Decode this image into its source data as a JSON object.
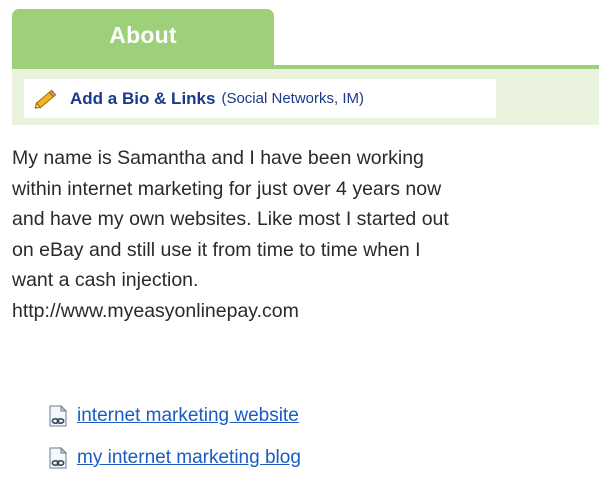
{
  "tab": {
    "label": "About"
  },
  "bio": {
    "link_label": "Add a Bio & Links",
    "sub_label": "(Social Networks, IM)"
  },
  "about_lines": [
    "My name is Samantha and I have been working",
    "within internet marketing for just over 4 years now",
    "and have my own websites. Like most I started out",
    "on eBay and still use it from time to time when I",
    "want a cash injection.",
    "http://www.myeasyonlinepay.com"
  ],
  "links": [
    {
      "label": "internet marketing website",
      "icon": "web-link-document-icon"
    },
    {
      "label": "my internet marketing blog",
      "icon": "web-link-document-icon"
    }
  ],
  "colors": {
    "tab_green": "#9ed07a",
    "bar_green": "#e9f2dd",
    "link_blue": "#1a5bc4",
    "bio_blue": "#1a3a8a"
  }
}
